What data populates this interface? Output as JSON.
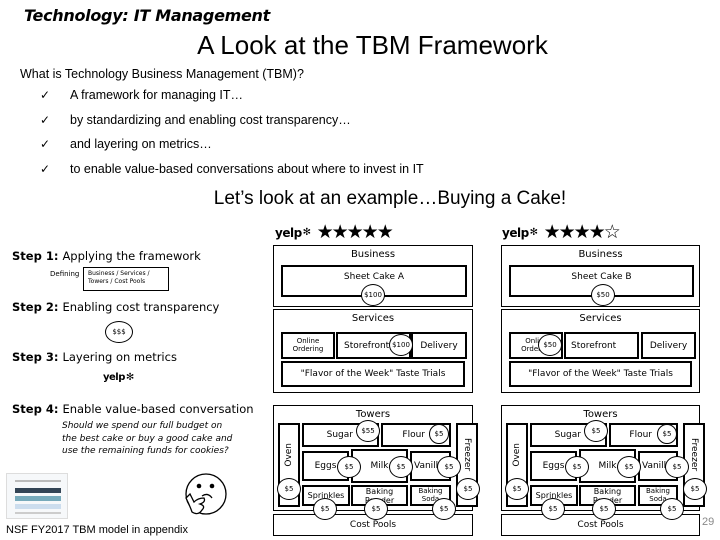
{
  "header": {
    "topic": "Technology: IT Management",
    "title": "A Look at the TBM Framework"
  },
  "intro": {
    "question": "What is Technology Business Management (TBM)?",
    "check_icon": "✓",
    "bullets": [
      "A framework for managing IT…",
      "by standardizing and enabling cost transparency…",
      "and layering on metrics…",
      "to enable value-based conversations about where to invest in IT"
    ]
  },
  "example_title": "Let’s look at an example…Buying a Cake!",
  "steps": [
    {
      "label": "Step 1:",
      "text": "Applying the framework"
    },
    {
      "label": "Step 2:",
      "text": "Enabling cost transparency"
    },
    {
      "label": "Step 3:",
      "text": "Layering on metrics"
    },
    {
      "label": "Step 4:",
      "text": "Enable value-based conversation"
    }
  ],
  "step1": {
    "defining_label": "Defining",
    "box_text": "Business / Services / Towers / Cost Pools"
  },
  "step2": {
    "money_symbol": "$$$"
  },
  "step3": {
    "logo": "yelp"
  },
  "step4": {
    "question": "Should we spend our full budget on the best cake or buy a good cake and use the remaining funds for cookies?"
  },
  "appendix_note": "NSF FY2017 TBM model in appendix",
  "page_number": "29",
  "yelp_logo": "yelp",
  "yelp_burst": "✻",
  "options": [
    {
      "rating": 5,
      "rating_max": 5,
      "stars_display": "★★★★★",
      "business_header": "Business",
      "product": "Sheet Cake A",
      "product_cost": "$100",
      "services_header": "Services",
      "services": [
        "Online Ordering",
        "Storefront",
        "Delivery"
      ],
      "service_cost": "$100",
      "service_cost_on": "Storefront",
      "promo": "\"Flavor of the Week\" Taste Trials",
      "towers_header": "Towers",
      "towers": {
        "oven": "Oven",
        "freezer": "Freezer",
        "sugar": "Sugar",
        "flour": "Flour",
        "eggs": "Eggs",
        "milk": "Milk",
        "vanilla": "Vanilla",
        "sprinkles": "Sprinkles",
        "baking_powder": "Baking Powder",
        "baking_soda": "Baking Soda"
      },
      "tower_costs": {
        "sugar": "$55",
        "flour": "$5",
        "eggs": "$5",
        "milk": "$5",
        "vanilla": "$5",
        "oven": "$5",
        "freezer": "$5",
        "sprinkles": "$5",
        "baking_powder": "$5",
        "baking_soda": "$5"
      },
      "cost_pools": "Cost Pools"
    },
    {
      "rating": 4.5,
      "rating_max": 5,
      "stars_display": "★★★★☆",
      "business_header": "Business",
      "product": "Sheet Cake B",
      "product_cost": "$50",
      "services_header": "Services",
      "services": [
        "Online Ordering",
        "Storefront",
        "Delivery"
      ],
      "service_cost": "$50",
      "service_cost_on": "Online Ordering",
      "promo": "\"Flavor of the Week\" Taste Trials",
      "towers_header": "Towers",
      "towers": {
        "oven": "Oven",
        "freezer": "Freezer",
        "sugar": "Sugar",
        "flour": "Flour",
        "eggs": "Eggs",
        "milk": "Milk",
        "vanilla": "Vanilla",
        "sprinkles": "Sprinkles",
        "baking_powder": "Baking Powder",
        "baking_soda": "Baking Soda"
      },
      "tower_costs": {
        "sugar": "$5",
        "flour": "$5",
        "eggs": "$5",
        "milk": "$5",
        "vanilla": "$5",
        "oven": "$5",
        "freezer": "$5",
        "sprinkles": "$5",
        "baking_powder": "$5",
        "baking_soda": "$5"
      },
      "cost_pools": "Cost Pools"
    }
  ]
}
